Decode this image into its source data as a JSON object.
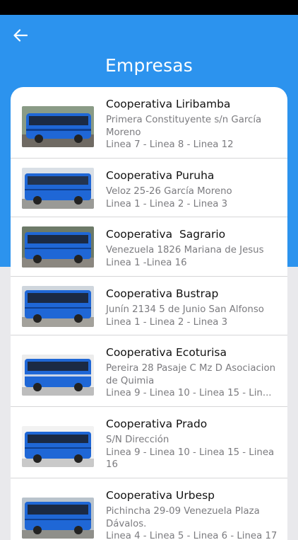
{
  "header": {
    "title": "Empresas",
    "back_icon": "arrow-left-icon"
  },
  "colors": {
    "header": "#2c93ee",
    "bus_body": "#1f67d6",
    "bus_window": "#1b2a44"
  },
  "companies": [
    {
      "name": "Cooperativa Liribamba",
      "address": "Primera Constituyente s/n García Moreno",
      "lines": "Linea 7 - Linea 8 - Linea 12"
    },
    {
      "name": "Cooperativa Puruha",
      "address": "Veloz 25-26 García Moreno",
      "lines": "Linea 1 - Linea 2 - Linea 3"
    },
    {
      "name": "Cooperativa  Sagrario",
      "address": "Venezuela 1826 Mariana de Jesus",
      "lines": "Linea 1 -Linea 16"
    },
    {
      "name": "Cooperativa Bustrap",
      "address": "Junín 2134 5 de Junio San Alfonso",
      "lines": "Linea 1 - Linea 2 - Linea 3"
    },
    {
      "name": "Cooperativa Ecoturisa",
      "address": "Pereira 28 Pasaje C Mz D Asociacion de Quimia",
      "lines": "Linea 9 - Linea 10 - Linea 15 - Lin..."
    },
    {
      "name": "Cooperativa Prado",
      "address": "S/N Dirección",
      "lines": "Linea 9 - Linea 10 - Linea 15 - Linea 16"
    },
    {
      "name": "Cooperativa Urbesp",
      "address": "Pichincha 29-09 Venezuela Plaza Dávalos.",
      "lines": "Linea 4 - Linea 5 - Linea 6 - Linea 17"
    }
  ]
}
